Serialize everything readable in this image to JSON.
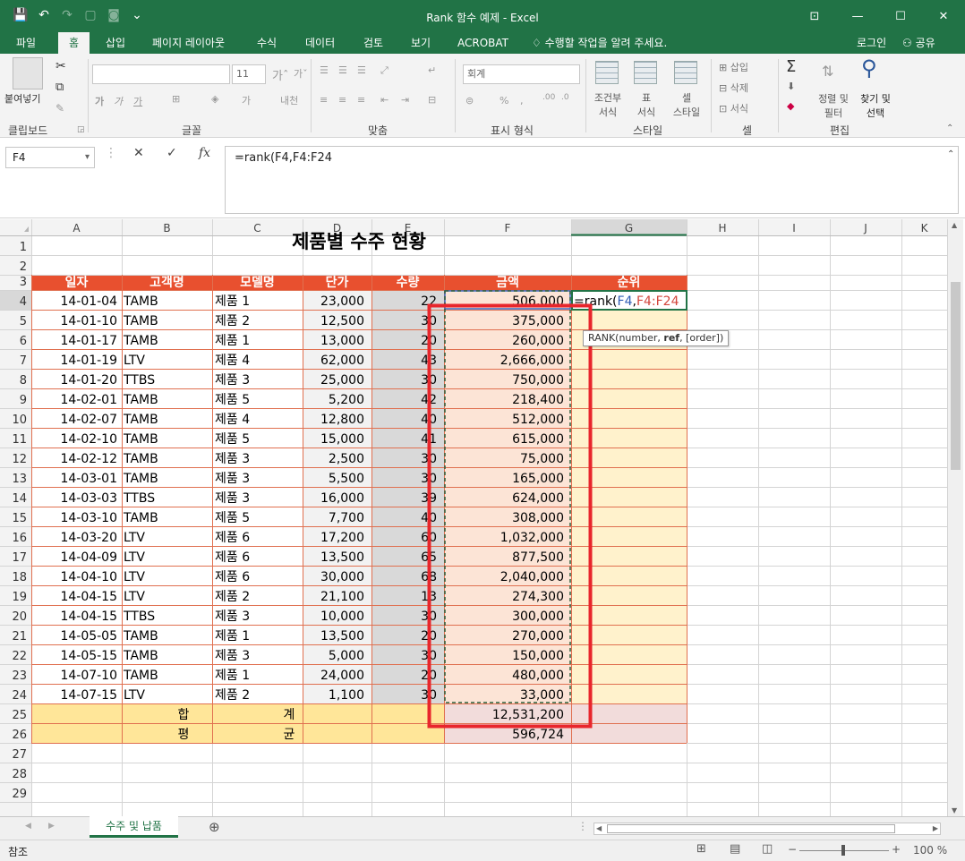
{
  "window": {
    "title": "Rank 함수 예제 - Excel"
  },
  "tabs": [
    "파일",
    "홈",
    "삽입",
    "페이지 레이아웃",
    "수식",
    "데이터",
    "검토",
    "보기",
    "ACROBAT"
  ],
  "tell_me": "수행할 작업을 알려 주세요.",
  "signin": "로그인",
  "share": "공유",
  "ribbon": {
    "paste": "붙여넣기",
    "font_size": "11",
    "number_format": "회계",
    "cond_format": [
      "조건부",
      "서식"
    ],
    "table_format": [
      "표",
      "서식"
    ],
    "cell_style": [
      "셀",
      "스타일"
    ],
    "insert": "삽입",
    "delete": "삭제",
    "format": "서식",
    "sort_filter": [
      "정렬 및",
      "필터"
    ],
    "find_select": [
      "찾기 및",
      "선택"
    ],
    "groups": [
      "클립보드",
      "글꼴",
      "맞춤",
      "표시 형식",
      "스타일",
      "셀",
      "편집"
    ]
  },
  "formula_bar": {
    "name_box": "F4",
    "formula": "=rank(F4,F4:F24"
  },
  "columns": [
    "A",
    "B",
    "C",
    "D",
    "E",
    "F",
    "G",
    "H",
    "I",
    "J",
    "K"
  ],
  "sheet": {
    "title": "제품별 수주 현황",
    "headers": [
      "일자",
      "고객명",
      "모델명",
      "단가",
      "수량",
      "금액",
      "순위"
    ],
    "rows": [
      [
        "14-01-04",
        "TAMB",
        "제품 1",
        "23,000",
        "22",
        "506,000"
      ],
      [
        "14-01-10",
        "TAMB",
        "제품 2",
        "12,500",
        "30",
        "375,000"
      ],
      [
        "14-01-17",
        "TAMB",
        "제품 1",
        "13,000",
        "20",
        "260,000"
      ],
      [
        "14-01-19",
        "LTV",
        "제품 4",
        "62,000",
        "43",
        "2,666,000"
      ],
      [
        "14-01-20",
        "TTBS",
        "제품 3",
        "25,000",
        "30",
        "750,000"
      ],
      [
        "14-02-01",
        "TAMB",
        "제품 5",
        "5,200",
        "42",
        "218,400"
      ],
      [
        "14-02-07",
        "TAMB",
        "제품 4",
        "12,800",
        "40",
        "512,000"
      ],
      [
        "14-02-10",
        "TAMB",
        "제품 5",
        "15,000",
        "41",
        "615,000"
      ],
      [
        "14-02-12",
        "TAMB",
        "제품 3",
        "2,500",
        "30",
        "75,000"
      ],
      [
        "14-03-01",
        "TAMB",
        "제품 3",
        "5,500",
        "30",
        "165,000"
      ],
      [
        "14-03-03",
        "TTBS",
        "제품 3",
        "16,000",
        "39",
        "624,000"
      ],
      [
        "14-03-10",
        "TAMB",
        "제품 5",
        "7,700",
        "40",
        "308,000"
      ],
      [
        "14-03-20",
        "LTV",
        "제품 6",
        "17,200",
        "60",
        "1,032,000"
      ],
      [
        "14-04-09",
        "LTV",
        "제품 6",
        "13,500",
        "65",
        "877,500"
      ],
      [
        "14-04-10",
        "LTV",
        "제품 6",
        "30,000",
        "68",
        "2,040,000"
      ],
      [
        "14-04-15",
        "LTV",
        "제품 2",
        "21,100",
        "13",
        "274,300"
      ],
      [
        "14-04-15",
        "TTBS",
        "제품 3",
        "10,000",
        "30",
        "300,000"
      ],
      [
        "14-05-05",
        "TAMB",
        "제품 1",
        "13,500",
        "20",
        "270,000"
      ],
      [
        "14-05-15",
        "TAMB",
        "제품 3",
        "5,000",
        "30",
        "150,000"
      ],
      [
        "14-07-10",
        "TAMB",
        "제품 1",
        "24,000",
        "20",
        "480,000"
      ],
      [
        "14-07-15",
        "LTV",
        "제품 2",
        "1,100",
        "30",
        "33,000"
      ]
    ],
    "total_label": [
      "합",
      "계"
    ],
    "total_value": "12,531,200",
    "avg_label": [
      "평",
      "균"
    ],
    "avg_value": "596,724",
    "editing_prefix": "=rank(",
    "editing_arg1": "F4",
    "editing_comma": ",",
    "editing_arg2": "F4:F24",
    "tooltip_prefix": "RANK(number, ",
    "tooltip_bold": "ref",
    "tooltip_suffix": ", [order])"
  },
  "sheet_tab": "수주 및 납품",
  "status": {
    "mode": "참조",
    "zoom": "100 %"
  },
  "colors": {
    "header_red": "#e8502f",
    "total_yellow": "#ffe699",
    "amount_fill": "#fce4d6",
    "rank_fill": "#fff2cc",
    "highlight": "#e8262c",
    "excel_green": "#217346"
  }
}
